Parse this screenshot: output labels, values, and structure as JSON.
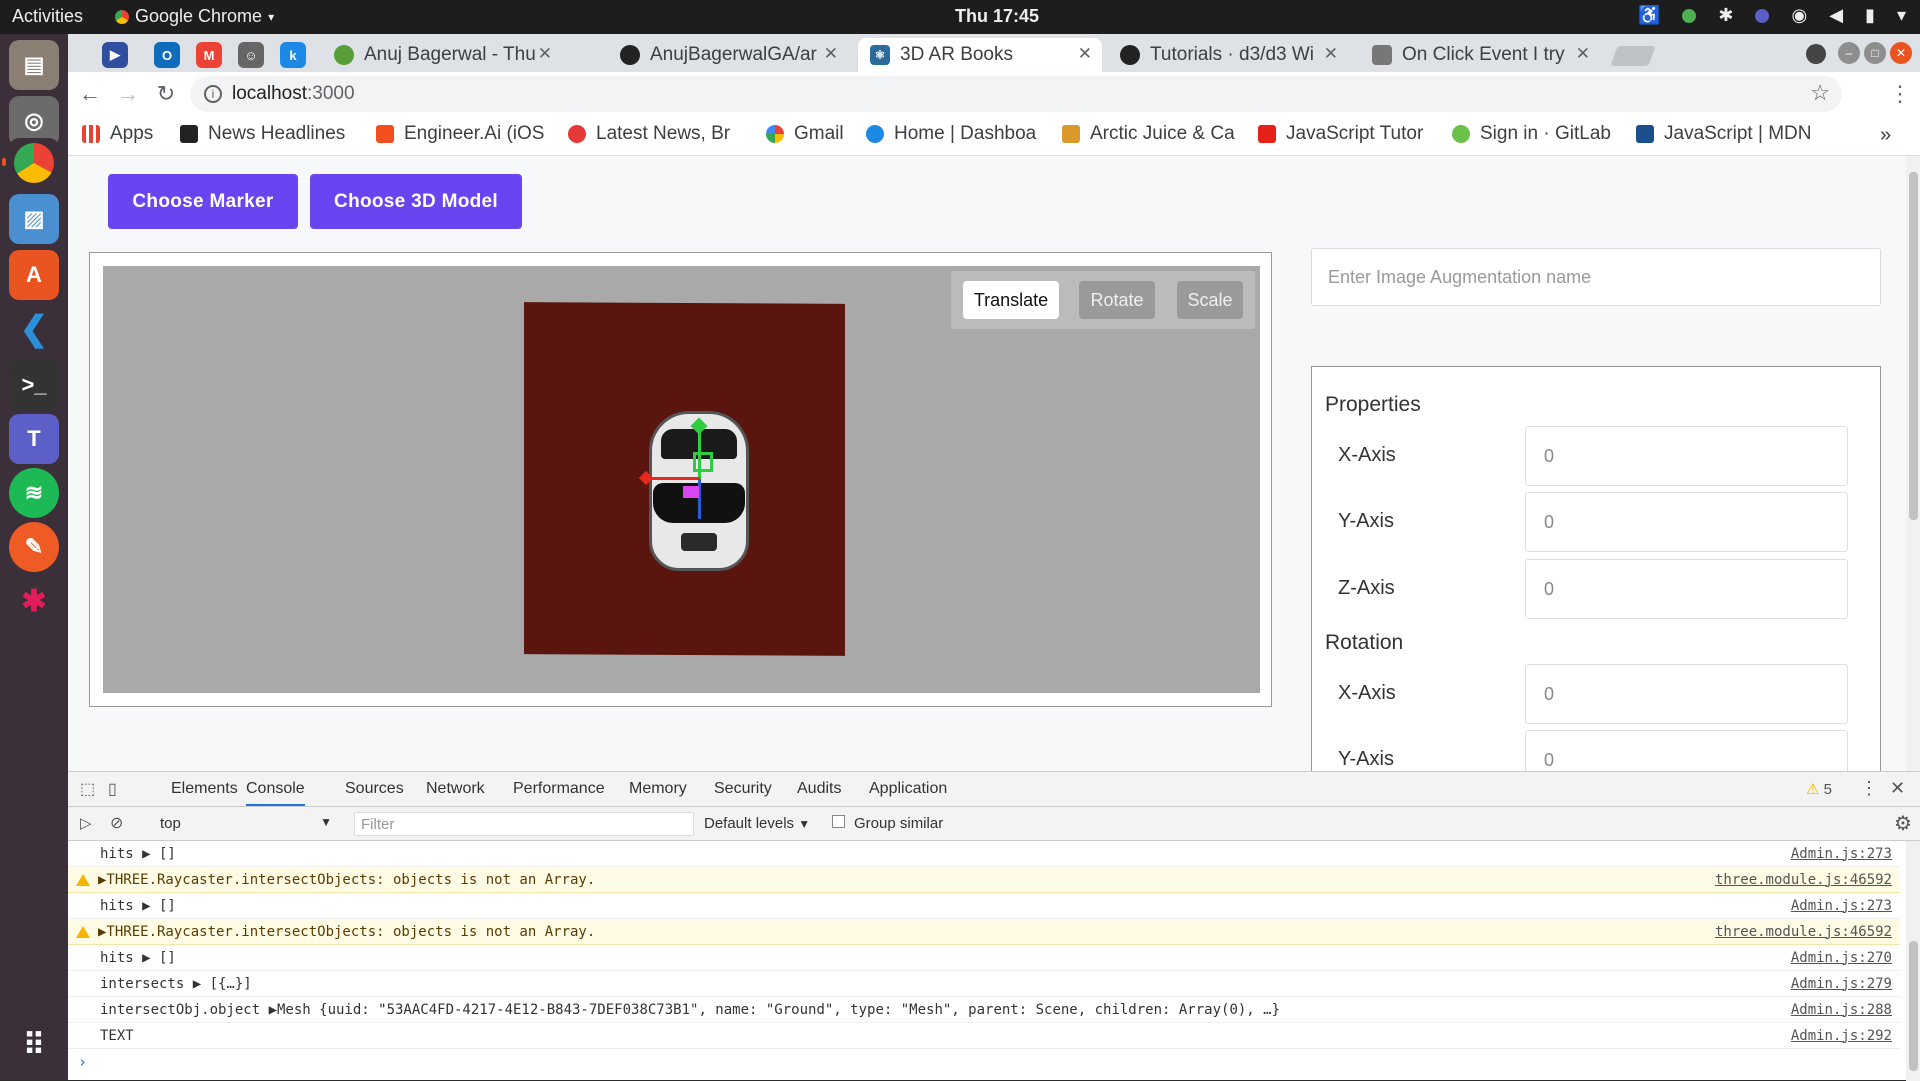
{
  "system": {
    "activities": "Activities",
    "app_name": "Google Chrome",
    "clock": "Thu 17:45"
  },
  "tabs": [
    {
      "label": "Anuj Bagerwal - Thu",
      "color": "#5a9e3a"
    },
    {
      "label": "AnujBagerwalGA/ar",
      "color": "#222222"
    },
    {
      "label": "3D AR Books",
      "color": "#2a6b9c"
    },
    {
      "label": "Tutorials · d3/d3 Wi",
      "color": "#222222"
    },
    {
      "label": "On Click Event I try",
      "color": "#777777"
    }
  ],
  "address": {
    "host": "localhost",
    "port": ":3000"
  },
  "bookmarks": [
    {
      "label": "Apps",
      "color": "#e94235"
    },
    {
      "label": "News Headlines",
      "color": "#222222"
    },
    {
      "label": "Engineer.Ai (iOS",
      "color": "#f24e1e"
    },
    {
      "label": "Latest News, Br",
      "color": "#e53935"
    },
    {
      "label": "Gmail",
      "color": "#ea4335"
    },
    {
      "label": "Home | Dashboa",
      "color": "#1e88e5"
    },
    {
      "label": "Arctic Juice & Ca",
      "color": "#d99a2b"
    },
    {
      "label": "JavaScript Tutor",
      "color": "#e62117"
    },
    {
      "label": "Sign in · GitLab",
      "color": "#6cc04a"
    },
    {
      "label": "JavaScript | MDN",
      "color": "#1a4f8b"
    }
  ],
  "page": {
    "choose_marker": "Choose Marker",
    "choose_model": "Choose 3D Model",
    "controls": {
      "translate": "Translate",
      "rotate": "Rotate",
      "scale": "Scale",
      "active": "Translate"
    },
    "augmentation_placeholder": "Enter Image Augmentation name",
    "properties_title": "Properties",
    "rotation_title": "Rotation",
    "properties": [
      {
        "label": "X-Axis",
        "value": "0"
      },
      {
        "label": "Y-Axis",
        "value": "0"
      },
      {
        "label": "Z-Axis",
        "value": "0"
      }
    ],
    "rotation": [
      {
        "label": "X-Axis",
        "value": "0"
      },
      {
        "label": "Y-Axis",
        "value": "0"
      }
    ]
  },
  "devtools": {
    "tabs": [
      "Elements",
      "Console",
      "Sources",
      "Network",
      "Performance",
      "Memory",
      "Security",
      "Audits",
      "Application"
    ],
    "active_tab": "Console",
    "warning_count": "5",
    "context": "top",
    "filter_placeholder": "Filter",
    "levels": "Default levels",
    "group_similar": "Group similar",
    "console": [
      {
        "type": "log",
        "text": "hits ▶ []",
        "source": "Admin.js:273"
      },
      {
        "type": "warn",
        "text": "▶THREE.Raycaster.intersectObjects: objects is not an Array.",
        "source": "three.module.js:46592"
      },
      {
        "type": "log",
        "text": "hits ▶ []",
        "source": "Admin.js:273"
      },
      {
        "type": "warn",
        "text": "▶THREE.Raycaster.intersectObjects: objects is not an Array.",
        "source": "three.module.js:46592"
      },
      {
        "type": "log",
        "text": "hits ▶ []",
        "source": "Admin.js:270"
      },
      {
        "type": "log",
        "text": "intersects ▶ [{…}]",
        "source": "Admin.js:279"
      },
      {
        "type": "log",
        "text": "intersectObj.object ▶Mesh {uuid: \"53AAC4FD-4217-4E12-B843-7DEF038C73B1\", name: \"Ground\", type: \"Mesh\", parent: Scene, children: Array(0), …}",
        "source": "Admin.js:288"
      },
      {
        "type": "log",
        "text": "TEXT",
        "source": "Admin.js:292"
      }
    ]
  }
}
